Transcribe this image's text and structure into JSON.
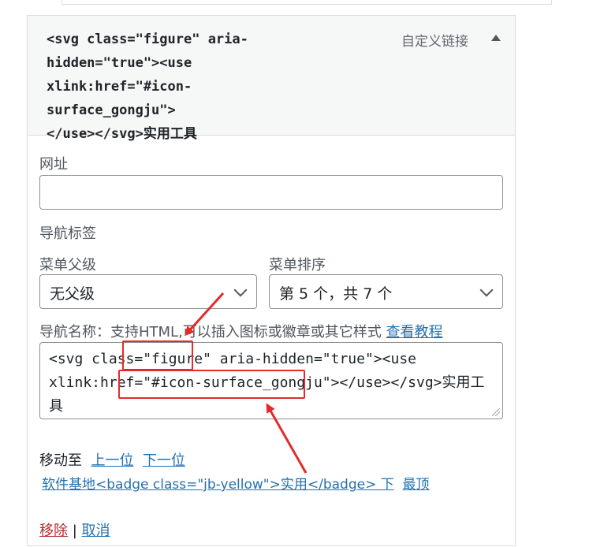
{
  "item": {
    "title": "<svg class=\"figure\" aria-\nhidden=\"true\"><use\nxlink:href=\"#icon-surface_gongju\">\n</use></svg>",
    "title_strong": "实用工具",
    "type": "自定义链接"
  },
  "fields": {
    "url_label": "网址",
    "url_value": "",
    "nav_label_label": "导航标签",
    "parent_label": "菜单父级",
    "parent_value": "无父级",
    "order_label": "菜单排序",
    "order_value": "第 5 个，共 7 个",
    "nav_name_label": "导航名称：支持HTML,可以插入图标或徽章或其它样式",
    "tutorial_link": "查看教程",
    "nav_name_value": "<svg class=\"figure\" aria-hidden=\"true\"><use\nxlink:href=\"#icon-surface_gongju\"></use></svg>实用工具"
  },
  "move": {
    "label": "移动至",
    "up": "上一位",
    "down": "下一位",
    "under": "软件基地<badge class=\"jb-yellow\">实用</badge> 下",
    "top": "最顶"
  },
  "actions": {
    "remove": "移除",
    "separator": "|",
    "cancel": "取消"
  },
  "colors": {
    "link": "#2271b1",
    "remove": "#b32d2e",
    "annotation": "#e52a2a"
  }
}
